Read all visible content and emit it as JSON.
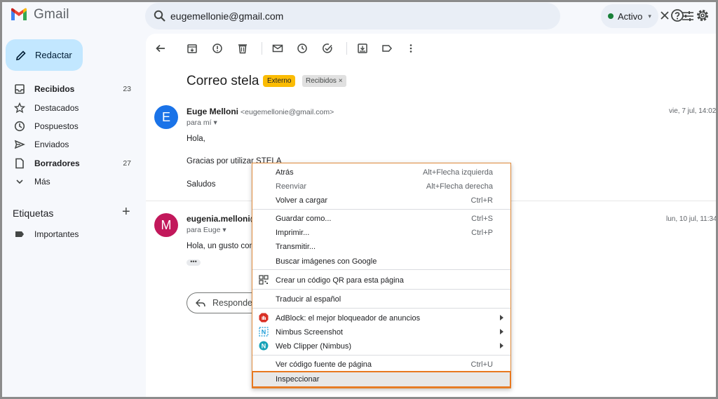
{
  "header": {
    "app_name": "Gmail",
    "search_value": "eugemellonie@gmail.com",
    "status": "Activo"
  },
  "sidebar": {
    "compose_label": "Redactar",
    "items": [
      {
        "label": "Recibidos",
        "count": "23",
        "bold": true,
        "icon": "inbox-icon"
      },
      {
        "label": "Destacados",
        "count": "",
        "bold": false,
        "icon": "star-icon"
      },
      {
        "label": "Pospuestos",
        "count": "",
        "bold": false,
        "icon": "clock-icon"
      },
      {
        "label": "Enviados",
        "count": "",
        "bold": false,
        "icon": "send-icon"
      },
      {
        "label": "Borradores",
        "count": "27",
        "bold": true,
        "icon": "draft-icon"
      },
      {
        "label": "Más",
        "count": "",
        "bold": false,
        "icon": "chevron-down-icon"
      }
    ],
    "labels_title": "Etiquetas",
    "labels": [
      {
        "label": "Importantes",
        "icon": "label-important-icon"
      }
    ]
  },
  "thread": {
    "subject": "Correo stela",
    "badge_external": "Externo",
    "badge_inbox": "Recibidos",
    "messages": [
      {
        "avatar_letter": "E",
        "avatar_color": "#1a73e8",
        "sender": "Euge Melloni",
        "email": "<eugemellonie@gmail.com>",
        "to": "para mí",
        "date": "vie, 7 jul, 14:02",
        "lines": [
          "Hola,",
          "Gracias por utilizar STELA",
          "Saludos"
        ]
      },
      {
        "avatar_letter": "M",
        "avatar_color": "#c2185b",
        "sender": "eugenia.melloni@",
        "to": "para Euge",
        "date": "lun, 10 jul, 11:34",
        "lines": [
          "Hola, un gusto conoc"
        ]
      }
    ],
    "reply_label": "Responder"
  },
  "context_menu": {
    "items": [
      {
        "label": "Atrás",
        "shortcut": "Alt+Flecha izquierda"
      },
      {
        "label": "Reenviar",
        "shortcut": "Alt+Flecha derecha"
      },
      {
        "label": "Volver a cargar",
        "shortcut": "Ctrl+R"
      },
      {
        "label": "Guardar como...",
        "shortcut": "Ctrl+S"
      },
      {
        "label": "Imprimir...",
        "shortcut": "Ctrl+P"
      },
      {
        "label": "Transmitir...",
        "shortcut": ""
      },
      {
        "label": "Buscar imágenes con Google",
        "shortcut": ""
      },
      {
        "label": "Crear un código QR para esta página",
        "shortcut": "",
        "icon": "qr-code-icon"
      },
      {
        "label": "Traducir al español",
        "shortcut": ""
      },
      {
        "label": "AdBlock: el mejor bloqueador de anuncios",
        "shortcut": "",
        "icon": "adblock-icon",
        "submenu": true
      },
      {
        "label": "Nimbus Screenshot",
        "shortcut": "",
        "icon": "nimbus-screenshot-icon",
        "submenu": true
      },
      {
        "label": "Web Clipper (Nimbus)",
        "shortcut": "",
        "icon": "nimbus-clipper-icon",
        "submenu": true
      },
      {
        "label": "Ver código fuente de página",
        "shortcut": "Ctrl+U"
      },
      {
        "label": "Inspeccionar",
        "shortcut": ""
      }
    ],
    "highlight_color": "#e8781f"
  }
}
